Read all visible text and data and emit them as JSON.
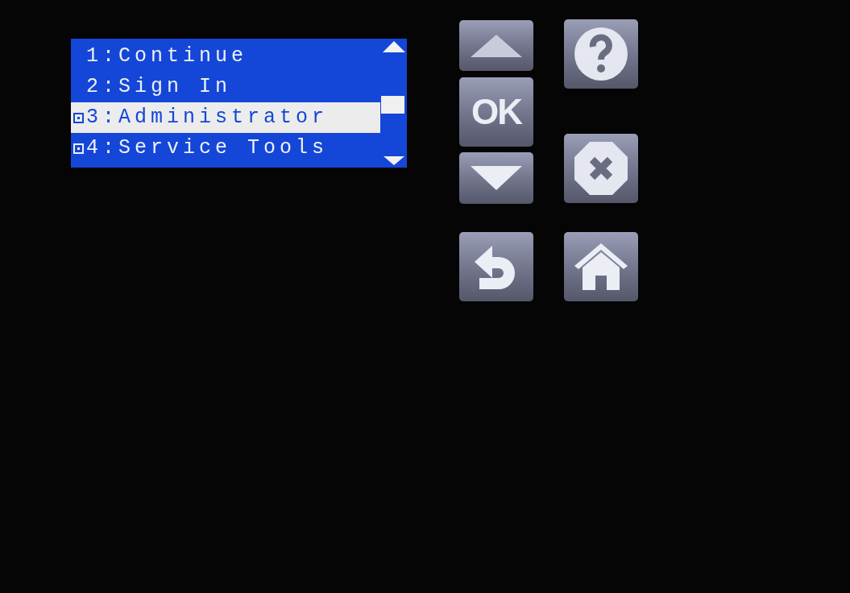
{
  "menu": {
    "items": [
      {
        "label": "1:Continue",
        "selected": false,
        "expandable": false
      },
      {
        "label": "2:Sign In",
        "selected": false,
        "expandable": false
      },
      {
        "label": "3:Administrator",
        "selected": true,
        "expandable": true
      },
      {
        "label": "4:Service Tools",
        "selected": false,
        "expandable": true
      }
    ]
  },
  "buttons": {
    "column_1": [
      {
        "kind": "up"
      },
      {
        "kind": "ok",
        "label": "OK"
      },
      {
        "kind": "down"
      },
      {
        "kind": "back"
      }
    ],
    "column_2": [
      {
        "kind": "help"
      },
      {
        "kind": "stop"
      },
      {
        "kind": "home"
      }
    ]
  }
}
